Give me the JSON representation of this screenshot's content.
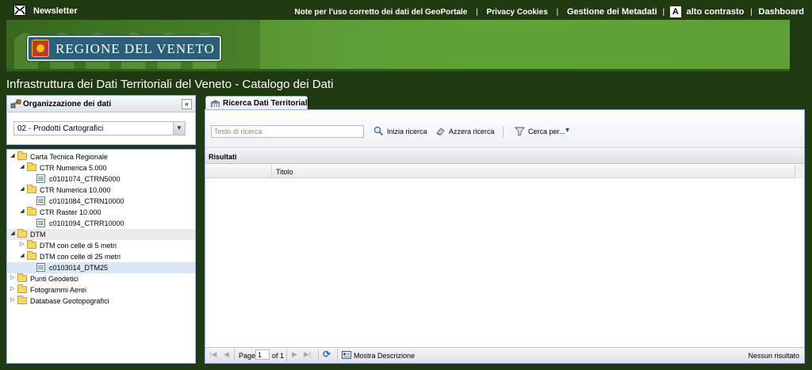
{
  "topbar": {
    "newsletter": "Newsletter",
    "links": {
      "note": "Note per l'uso corretto dei dati del GeoPortale",
      "privacy": "Privacy Cookies",
      "metadata": "Gestione dei Metadati",
      "contrast": "alto contrasto",
      "dashboard": "Dashboard"
    },
    "separator": "|",
    "contrast_icon_letter": "A"
  },
  "banner": {
    "logo_text": "REGIONE DEL VENETO"
  },
  "page": {
    "title": "Infrastruttura dei Dati Territoriali del Veneto - Catalogo dei Dati"
  },
  "left_panel": {
    "header": "Organizzazione dei dati",
    "collapse": "«",
    "combo_value": "02 - Prodotti Cartografici",
    "combo_arrow": "▼"
  },
  "tree": {
    "items": [
      {
        "label": "Carta Tecnica Regionale",
        "level": 0,
        "type": "folder",
        "expanded": true
      },
      {
        "label": "CTR Numerica 5.000",
        "level": 1,
        "type": "folder",
        "expanded": true
      },
      {
        "label": "c0101074_CTRN5000",
        "level": 2,
        "type": "leaf"
      },
      {
        "label": "CTR Numerica 10.000",
        "level": 1,
        "type": "folder",
        "expanded": true
      },
      {
        "label": "c0101084_CTRN10000",
        "level": 2,
        "type": "leaf"
      },
      {
        "label": "CTR Raster 10.000",
        "level": 1,
        "type": "folder",
        "expanded": true
      },
      {
        "label": "c0101094_CTRR10000",
        "level": 2,
        "type": "leaf"
      },
      {
        "label": "DTM",
        "level": 0,
        "type": "folder",
        "expanded": true,
        "hover": true
      },
      {
        "label": "DTM con celle di 5 metri",
        "level": 1,
        "type": "folder",
        "expanded": false
      },
      {
        "label": "DTM con celle di 25 metri",
        "level": 1,
        "type": "folder",
        "expanded": true
      },
      {
        "label": "c0103014_DTM25",
        "level": 2,
        "type": "leaf",
        "selected": true
      },
      {
        "label": "Punti Geodetici",
        "level": 0,
        "type": "folder",
        "expanded": false
      },
      {
        "label": "Fotogrammi Aerei",
        "level": 0,
        "type": "folder",
        "expanded": false
      },
      {
        "label": "Database Geotopografici",
        "level": 0,
        "type": "folder",
        "expanded": false
      }
    ]
  },
  "tab": {
    "label": "Ricerca Dati Territoriali"
  },
  "toolbar": {
    "search_placeholder": "Testo di ricerca",
    "start_search": "Inizia ricerca",
    "reset_search": "Azzera ricerca",
    "search_by": "Cerca per...",
    "dropdown_arrow": "▾"
  },
  "results": {
    "header": "Risultati",
    "columns": [
      "",
      "Titolo"
    ]
  },
  "paging": {
    "page_label": "Page",
    "page_value": "1",
    "of_label": "of 1",
    "show_description": "Mostra Descrizione",
    "status": "Nessun risultato",
    "first": "|◀",
    "prev": "◀",
    "next": "▶",
    "last": "▶|",
    "refresh": "⟳"
  },
  "colors": {
    "background": "#1f3a10",
    "banner_green": "#5d9c35",
    "panel_border": "#99bbe8",
    "selected_row": "#dbe7f6"
  }
}
